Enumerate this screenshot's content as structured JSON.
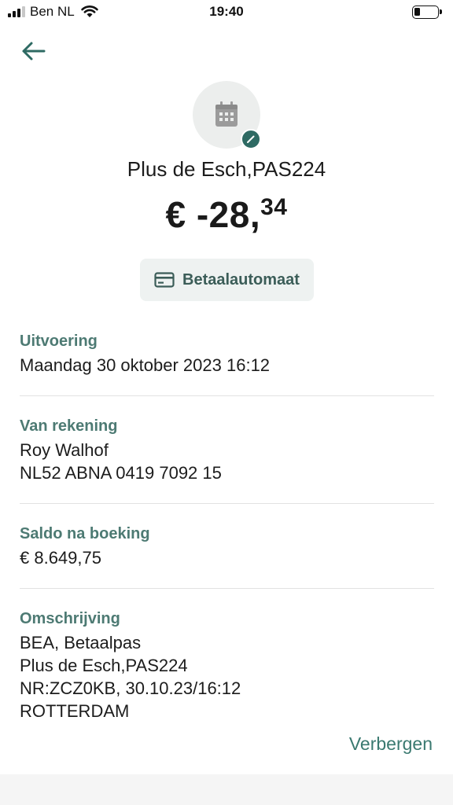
{
  "status_bar": {
    "carrier": "Ben NL",
    "time": "19:40",
    "battery_percent": 20
  },
  "header": {
    "merchant": "Plus de Esch,PAS224",
    "amount_main": "€ -28,",
    "amount_cents": "34",
    "transaction_type": "Betaalautomaat",
    "category_icon": "calendar-icon"
  },
  "details": {
    "uitvoering": {
      "label": "Uitvoering",
      "value": "Maandag 30 oktober 2023 16:12"
    },
    "van_rekening": {
      "label": "Van rekening",
      "name": "Roy Walhof",
      "iban": "NL52 ABNA 0419 7092 15"
    },
    "saldo": {
      "label": "Saldo na boeking",
      "value": "€ 8.649,75"
    },
    "omschrijving": {
      "label": "Omschrijving",
      "lines": [
        "BEA, Betaalpas",
        "Plus de Esch,PAS224",
        "NR:ZCZ0KB, 30.10.23/16:12",
        "ROTTERDAM"
      ]
    }
  },
  "actions": {
    "hide_label": "Verbergen"
  },
  "colors": {
    "accent": "#2e6a63",
    "label": "#4d7a73",
    "chip_bg": "#eef2f1"
  }
}
